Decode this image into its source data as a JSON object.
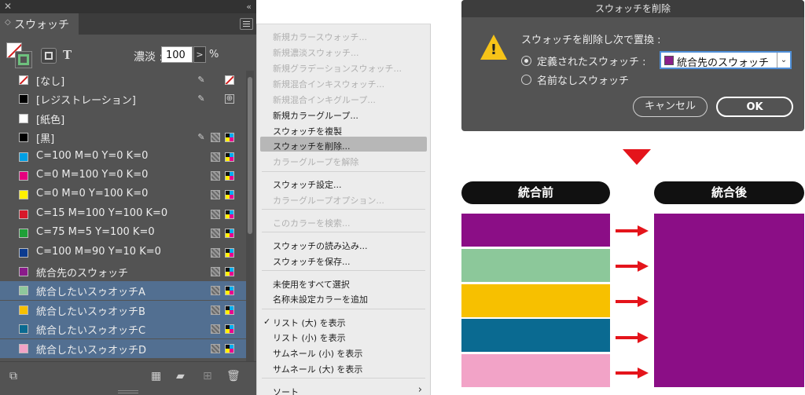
{
  "swatches_panel": {
    "close_glyph": "✕",
    "collapse_glyph": "«",
    "tab_title": "スウォッチ",
    "text_tool_glyph": "T",
    "tint_label": "濃淡 :",
    "tint_value": "100",
    "tint_step_glyph": ">",
    "tint_unit": "%",
    "rows": [
      {
        "label": "[なし]",
        "color": "none",
        "icons": [
          "lock-icon",
          "none-icon"
        ],
        "selected": false
      },
      {
        "label": "[レジストレーション]",
        "color": "#000000",
        "icons": [
          "lock-icon",
          "registration-icon"
        ],
        "selected": false
      },
      {
        "label": "[紙色]",
        "color": "#ffffff",
        "icons": [],
        "selected": false
      },
      {
        "label": "[黒]",
        "color": "#000000",
        "icons": [
          "lock-icon",
          "color-mode-icon",
          "cmyk-icon"
        ],
        "selected": false
      },
      {
        "label": "C=100 M=0 Y=0 K=0",
        "color": "#009fe3",
        "icons": [
          "color-mode-icon",
          "cmyk-icon"
        ],
        "selected": false
      },
      {
        "label": "C=0 M=100 Y=0 K=0",
        "color": "#e5007e",
        "icons": [
          "color-mode-icon",
          "cmyk-icon"
        ],
        "selected": false
      },
      {
        "label": "C=0 M=0 Y=100 K=0",
        "color": "#fff100",
        "icons": [
          "color-mode-icon",
          "cmyk-icon"
        ],
        "selected": false
      },
      {
        "label": "C=15 M=100 Y=100 K=0",
        "color": "#d7182a",
        "icons": [
          "color-mode-icon",
          "cmyk-icon"
        ],
        "selected": false
      },
      {
        "label": "C=75 M=5 Y=100 K=0",
        "color": "#1fa038",
        "icons": [
          "color-mode-icon",
          "cmyk-icon"
        ],
        "selected": false
      },
      {
        "label": "C=100 M=90 Y=10 K=0",
        "color": "#0c3b8f",
        "icons": [
          "color-mode-icon",
          "cmyk-icon"
        ],
        "selected": false
      },
      {
        "label": "統合先のスウォッチ",
        "color": "#8a1b8a",
        "icons": [
          "color-mode-icon",
          "cmyk-icon"
        ],
        "selected": false
      },
      {
        "label": "統合したいスゥオッチA",
        "color": "#8fc89c",
        "icons": [
          "color-mode-icon",
          "cmyk-icon"
        ],
        "selected": true
      },
      {
        "label": "統合したいスゥオッチB",
        "color": "#f7c000",
        "icons": [
          "color-mode-icon",
          "cmyk-icon"
        ],
        "selected": true
      },
      {
        "label": "統合したいスゥオッチC",
        "color": "#0a6a91",
        "icons": [
          "color-mode-icon",
          "cmyk-icon"
        ],
        "selected": true
      },
      {
        "label": "統合したいスゥオッチD",
        "color": "#f1a3c6",
        "icons": [
          "color-mode-icon",
          "cmyk-icon"
        ],
        "selected": true
      }
    ]
  },
  "flyout_menu": {
    "items": [
      {
        "label": "新規カラースウォッチ...",
        "disabled": true
      },
      {
        "label": "新規濃淡スウォッチ...",
        "disabled": true
      },
      {
        "label": "新規グラデーションスウォッチ...",
        "disabled": true
      },
      {
        "label": "新規混合インキスウォッチ...",
        "disabled": true
      },
      {
        "label": "新規混合インキグループ...",
        "disabled": true
      },
      {
        "label": "新規カラーグループ...",
        "disabled": false
      },
      {
        "label": "スウォッチを複製",
        "disabled": false
      },
      {
        "label": "スウォッチを削除...",
        "disabled": false,
        "highlighted": true
      },
      {
        "label": "カラーグループを解除",
        "disabled": true
      },
      {
        "label": "スウォッチ設定...",
        "disabled": false
      },
      {
        "label": "カラーグループオプション...",
        "disabled": true
      },
      {
        "label": "このカラーを検索...",
        "disabled": true
      },
      {
        "label": "スウォッチの読み込み...",
        "disabled": false
      },
      {
        "label": "スウォッチを保存...",
        "disabled": false
      },
      {
        "label": "未使用をすべて選択",
        "disabled": false
      },
      {
        "label": "名称未設定カラーを追加",
        "disabled": false
      },
      {
        "label": "リスト (大) を表示",
        "disabled": false,
        "checked": true
      },
      {
        "label": "リスト (小) を表示",
        "disabled": false
      },
      {
        "label": "サムネール (小) を表示",
        "disabled": false
      },
      {
        "label": "サムネール (大) を表示",
        "disabled": false
      },
      {
        "label": "ソート",
        "disabled": false,
        "submenu": true
      }
    ],
    "check_glyph": "✓",
    "submenu_glyph": "›"
  },
  "delete_dialog": {
    "title": "スウォッチを削除",
    "warning_glyph": "!",
    "heading": "スウォッチを削除し次で置換 :",
    "option_defined": "定義されたスウォッチ :",
    "option_unnamed": "名前なしスウォッチ",
    "selected_swatch": "統合先のスウォッチ",
    "selected_swatch_color": "#8a1f8a",
    "dropdown_glyph": "⌄",
    "cancel_label": "キャンセル",
    "ok_label": "OK"
  },
  "diagram": {
    "before_label": "統合前",
    "after_label": "統合後",
    "before_colors": [
      "#8b0e86",
      "#8cc89a",
      "#f7c000",
      "#0a6a91",
      "#f2a3c7"
    ],
    "after_color": "#8b0e86",
    "arrow_color": "#e4141b"
  }
}
